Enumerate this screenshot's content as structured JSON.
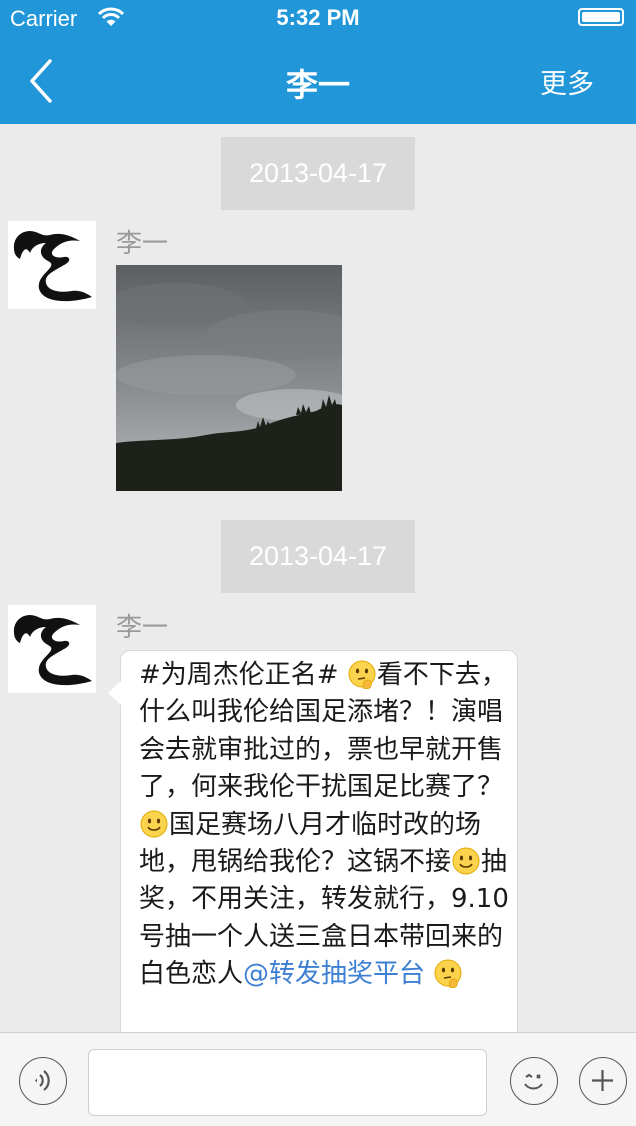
{
  "status": {
    "carrier": "Carrier",
    "time": "5:32 PM"
  },
  "nav": {
    "title": "李一",
    "more_label": "更多",
    "back_icon": "chevron-left-icon"
  },
  "colors": {
    "nav_bg": "#2196d8",
    "background": "#ebebeb",
    "date_pill": "#d9d9d9",
    "mention": "#3d7fd2"
  },
  "messages": [
    {
      "date": "2013-04-17",
      "sender": "李一",
      "type": "image",
      "image_desc": "cloudy sky over tree-covered hills"
    },
    {
      "date": "2013-04-17",
      "sender": "李一",
      "type": "text",
      "segments": [
        {
          "t": "#为周杰伦正名# "
        },
        {
          "emoji": "thinking-emoji"
        },
        {
          "t": "看不下去，什么叫我伦给国足添堵？！演唱会去就审批过的，票也早就开售了，何来我伦干扰国足比赛了？"
        },
        {
          "emoji": "smile-emoji"
        },
        {
          "t": "国足赛场八月才临时改的场地，甩锅给我伦？这锅不接"
        },
        {
          "emoji": "smile-emoji"
        },
        {
          "t": "抽奖，不用关注，转发就行，9.10号抽一个人送三盒日本带回来的白色恋人"
        },
        {
          "mention": "@转发抽奖平台"
        },
        {
          "t": " "
        },
        {
          "emoji": "thinking-emoji"
        }
      ]
    }
  ],
  "input": {
    "value": "",
    "placeholder": ""
  }
}
